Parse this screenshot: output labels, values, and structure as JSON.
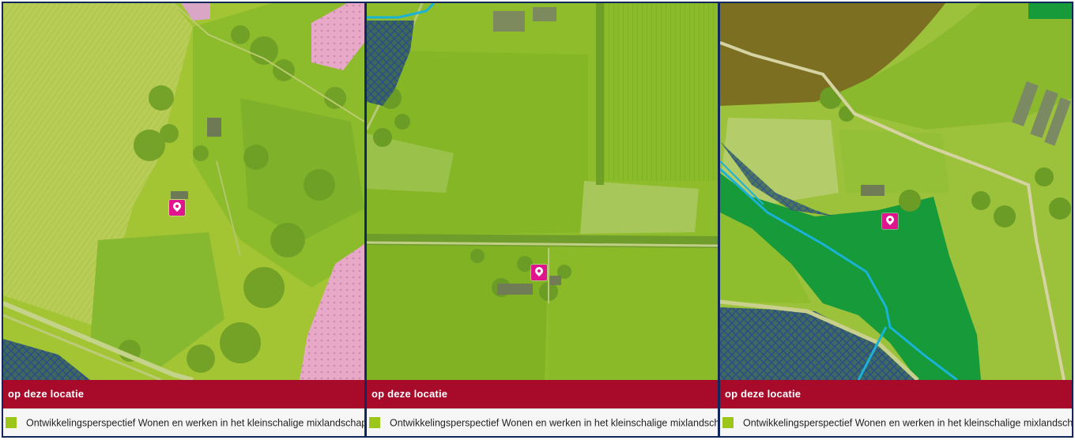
{
  "panels": [
    {
      "id": "left",
      "header_title": "op deze locatie",
      "legend_text": "Ontwikkelingsperspectief Wonen en werken in het kleinschalige mixlandschap -",
      "marker_icon": "location-pin-icon"
    },
    {
      "id": "middle",
      "header_title": "op deze locatie",
      "legend_text": "Ontwikkelingsperspectief Wonen en werken in het kleinschalige mixlandschap -",
      "marker_icon": "location-pin-icon"
    },
    {
      "id": "right",
      "header_title": "op deze locatie",
      "legend_text": "Ontwikkelingsperspectief Wonen en werken in het kleinschalige mixlandschap -",
      "marker_icon": "location-pin-icon"
    }
  ],
  "colors": {
    "header_background": "#a80b2a",
    "panel_border": "#12285c",
    "legend_swatch": "#9dc61a",
    "marker": "#e0148c",
    "overlay_mixlandschap": "#a8c52c",
    "overlay_dark_green": "#179a3a",
    "overlay_pink": "#e8a7c6",
    "overlay_brown": "#7d6f21",
    "hatch_blue": "#2b4a8c",
    "water_line": "#1ab2d6"
  }
}
